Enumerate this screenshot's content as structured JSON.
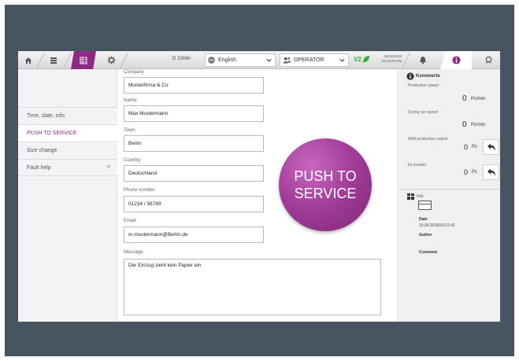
{
  "topbar": {
    "speed": "0 1/min",
    "language": "English",
    "role": "OPERATOR",
    "v2": "V2",
    "datetime_line1": "29/12/2018",
    "datetime_line2": "03:18:20 PM"
  },
  "menu": {
    "items": [
      {
        "label": "Time, date, info",
        "active": false
      },
      {
        "label": "PUSH TO SERVICE",
        "active": true
      },
      {
        "label": "Size change",
        "active": false
      },
      {
        "label": "Fault help",
        "active": false,
        "arrow": ">"
      }
    ]
  },
  "form": {
    "company_label": "Company",
    "company_value": "Musterfirma & Co",
    "name_label": "Name:",
    "name_value": "Max Mustermann",
    "town_label": "Town:",
    "town_value": "Berlin",
    "country_label": "Country:",
    "country_value": "Deutschland",
    "phone_label": "Phone number:",
    "phone_value": "01234 / 56789",
    "email_label": "Email:",
    "email_value": "m.mustermann@Berlin.de",
    "message_label": "Message:",
    "message_value": "Der Einzug zieht kein Papier ein"
  },
  "push_button": {
    "line1": "PUSH TO",
    "line2": "SERVICE",
    "color": "#a33e9a"
  },
  "kennwerte": {
    "title": "Kennwerte",
    "production_speed_label": "Production speed",
    "production_speed_value": "0",
    "production_speed_unit": "Pc/min",
    "drying_speed_label": "Drying run speed",
    "drying_speed_value": "0",
    "drying_speed_unit": "Pc/min",
    "shift_output_label": "Shift production output",
    "shift_output_value": "0",
    "shift_output_unit": "Pc",
    "lot_counter_label": "lot counter",
    "lot_counter_value": "0",
    "lot_counter_unit": "Pc"
  },
  "history": {
    "title": "Hist",
    "date_label": "Date",
    "date_value": "10.04.2018|10:12:41",
    "author_label": "Author",
    "comment_label": "Comment"
  },
  "colors": {
    "accent": "#8e2a84",
    "frame": "#46555f",
    "status_green": "#2fae3a"
  },
  "icons": [
    "home-icon",
    "list-icon",
    "grid-icon",
    "gear-icon",
    "globe-icon",
    "users-icon",
    "leaf-icon",
    "bell-icon",
    "info-icon",
    "headset-icon",
    "undo-icon",
    "history-icon",
    "card-icon"
  ]
}
